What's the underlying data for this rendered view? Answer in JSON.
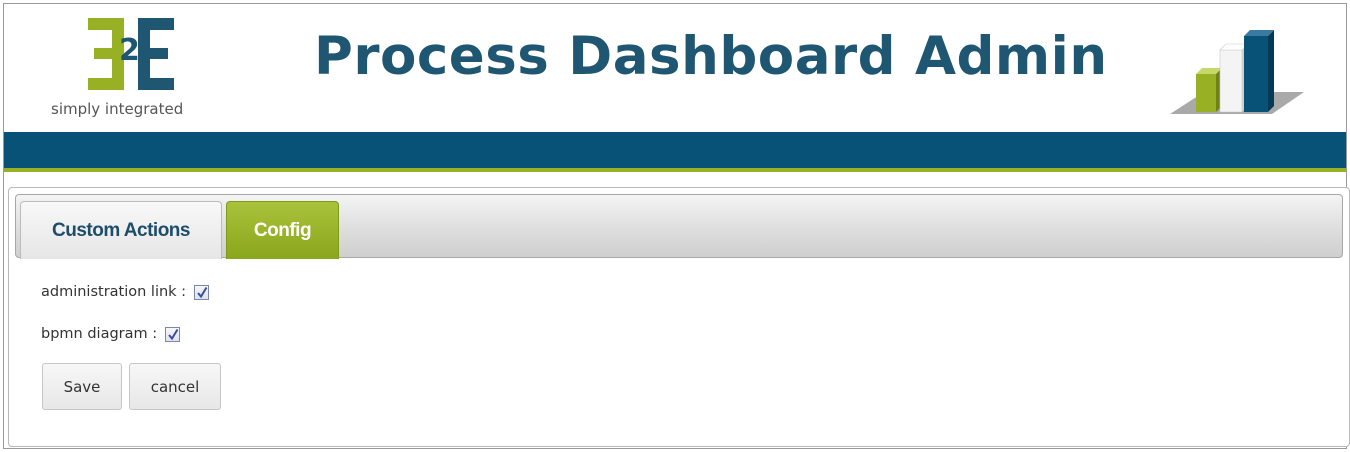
{
  "header": {
    "logo_tagline": "simply integrated",
    "title": "Process Dashboard Admin"
  },
  "tabs": [
    {
      "label": "Custom Actions",
      "active": false
    },
    {
      "label": "Config",
      "active": true
    }
  ],
  "config": {
    "administration_link_label": "administration link :",
    "administration_link_checked": true,
    "bpmn_diagram_label": "bpmn diagram :",
    "bpmn_diagram_checked": true
  },
  "buttons": {
    "save_label": "Save",
    "cancel_label": "cancel"
  },
  "colors": {
    "brand_blue": "#075276",
    "brand_green": "#98b024",
    "title_blue": "#1f5672"
  }
}
